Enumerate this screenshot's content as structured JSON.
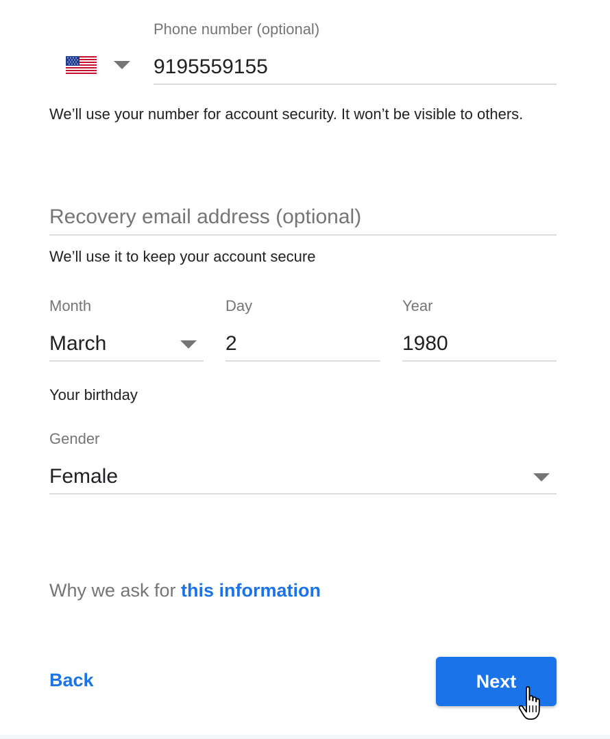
{
  "phone": {
    "label": "Phone number (optional)",
    "country_flag": "us-flag-icon",
    "value": "9195559155",
    "help": "We’ll use your number for account security. It won’t be visible to others."
  },
  "recovery": {
    "placeholder": "Recovery email address (optional)",
    "help": "We’ll use it to keep your account secure"
  },
  "birthday": {
    "month_label": "Month",
    "month_value": "March",
    "day_label": "Day",
    "day_value": "2",
    "year_label": "Year",
    "year_value": "1980",
    "help": "Your birthday"
  },
  "gender": {
    "label": "Gender",
    "value": "Female"
  },
  "why": {
    "prefix": "Why we ask for ",
    "link": "this information"
  },
  "actions": {
    "back_label": "Back",
    "next_label": "Next"
  },
  "colors": {
    "accent": "#1a73e8",
    "muted_text": "#757575",
    "underline": "#dadce0"
  }
}
